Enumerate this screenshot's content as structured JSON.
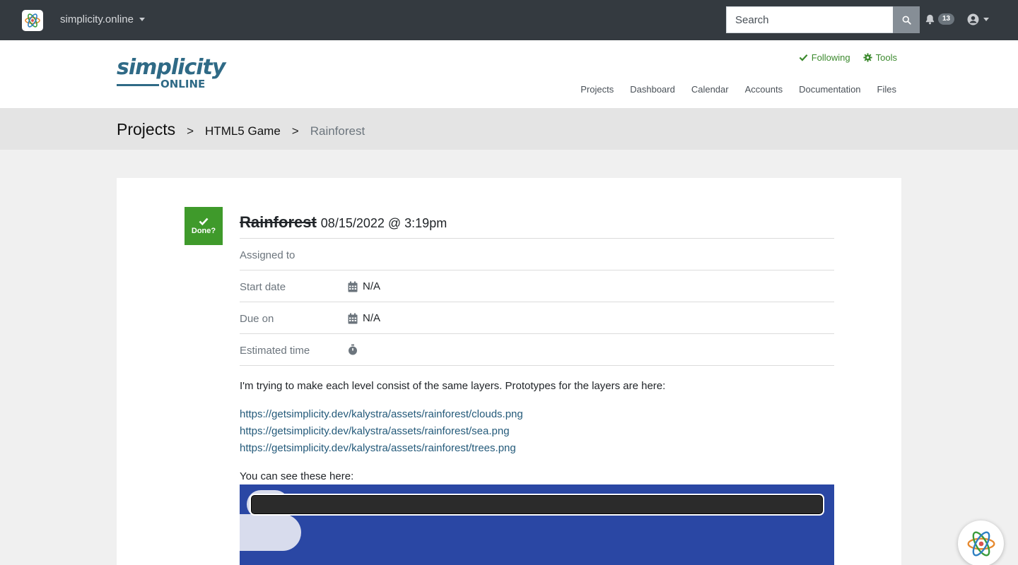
{
  "topbar": {
    "site_name": "simplicity.online",
    "search": {
      "placeholder": "Search",
      "value": ""
    },
    "notifications_count": "13"
  },
  "header": {
    "brand_line1": "simplicity",
    "brand_line2": "ONLINE",
    "following_label": "Following",
    "tools_label": "Tools",
    "nav": {
      "projects": "Projects",
      "dashboard": "Dashboard",
      "calendar": "Calendar",
      "accounts": "Accounts",
      "documentation": "Documentation",
      "files": "Files"
    }
  },
  "breadcrumb": {
    "root": "Projects",
    "sep1": ">",
    "project": "HTML5 Game",
    "sep2": ">",
    "current": "Rainforest"
  },
  "task": {
    "done_label": "Done?",
    "title": "Rainforest",
    "date": "08/15/2022 @ 3:19pm",
    "fields": {
      "assigned_label": "Assigned to",
      "start_label": "Start date",
      "start_value": "N/A",
      "due_label": "Due on",
      "due_value": "N/A",
      "estimate_label": "Estimated time"
    },
    "description": "I'm trying to make each level consist of the same layers. Prototypes for the layers are here:",
    "links": [
      "https://getsimplicity.dev/kalystra/assets/rainforest/clouds.png",
      "https://getsimplicity.dev/kalystra/assets/rainforest/sea.png",
      "https://getsimplicity.dev/kalystra/assets/rainforest/trees.png"
    ],
    "see_here": "You can see these here:"
  },
  "colors": {
    "topbar_bg": "#343a40",
    "brand": "#2f6a86",
    "accent_green": "#3f9a2b",
    "link": "#245a7a",
    "preview_sky": "#2a47a4"
  },
  "icons": {
    "app_logo": "atom-logo-icon",
    "search": "search-icon",
    "bell": "bell-icon",
    "user": "user-circle-icon",
    "following": "check-icon",
    "tools": "gear-icon",
    "done": "check-icon",
    "calendar": "calendar-icon",
    "stopwatch": "stopwatch-icon",
    "help": "atom-logo-icon"
  }
}
